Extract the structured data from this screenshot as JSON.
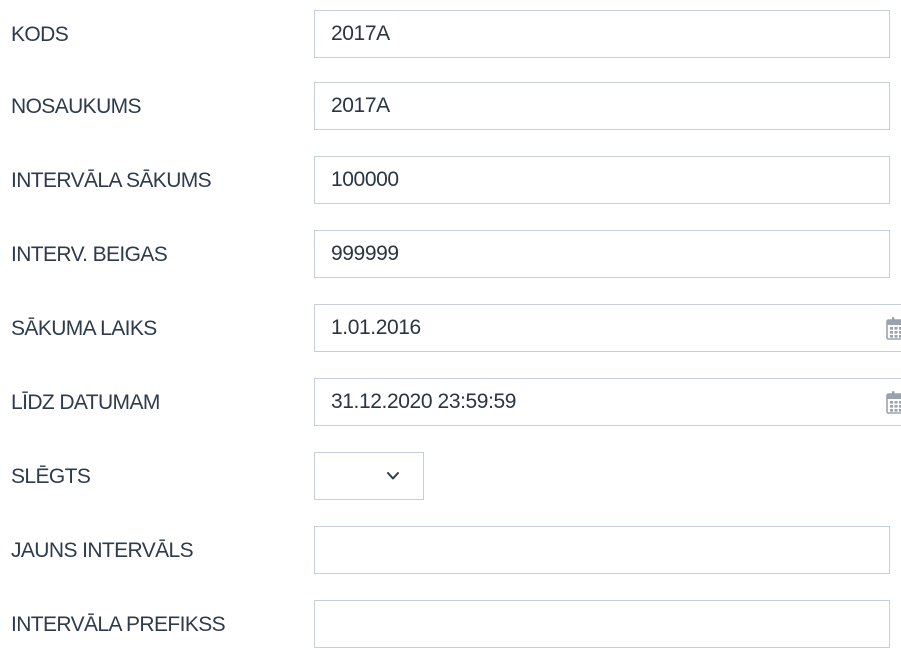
{
  "form": {
    "rows": [
      {
        "label": "KODS",
        "value": "2017A",
        "type": "text"
      },
      {
        "label": "NOSAUKUMS",
        "value": "2017A",
        "type": "text"
      },
      {
        "label": "INTERVĀLA SĀKUMS",
        "value": "100000",
        "type": "text"
      },
      {
        "label": "INTERV. BEIGAS",
        "value": "999999",
        "type": "text"
      },
      {
        "label": "SĀKUMA LAIKS",
        "value": "1.01.2016",
        "type": "date",
        "icon": "calendar-icon"
      },
      {
        "label": "LĪDZ DATUMAM",
        "value": "31.12.2020 23:59:59",
        "type": "date",
        "icon": "calendar-icon"
      },
      {
        "label": "SLĒGTS",
        "value": "",
        "type": "select",
        "icon": "chevron-down-icon"
      },
      {
        "label": "JAUNS INTERVĀLS",
        "value": "",
        "type": "text"
      },
      {
        "label": "INTERVĀLA PREFIKSS",
        "value": "",
        "type": "text"
      }
    ]
  },
  "colors": {
    "label": "#2d3b4c",
    "field_border": "#c6ced8",
    "icon": "#9aa3ad"
  }
}
